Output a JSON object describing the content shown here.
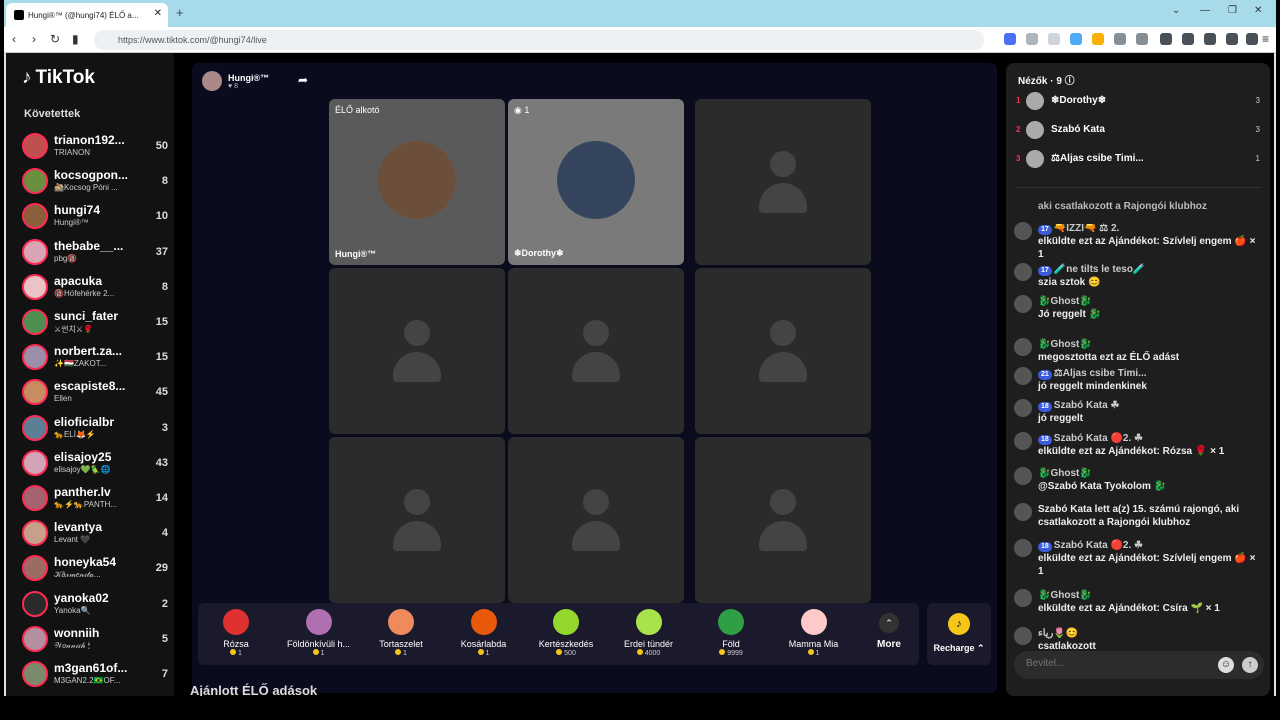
{
  "browser": {
    "tab_title": "Hungi®™ (@hungi74) ÉLŐ a...",
    "url": "https://www.tiktok.com/@hungi74/live"
  },
  "sidebar": {
    "logo": "TikTok",
    "following_title": "Követettek",
    "following": [
      {
        "name": "trianon192...",
        "sub": "TRIANON",
        "count": "50"
      },
      {
        "name": "kocsogpon...",
        "sub": "🚵Kocsog Póni ...",
        "count": "8"
      },
      {
        "name": "hungi74",
        "sub": "Hungi®™",
        "count": "10"
      },
      {
        "name": "thebabe__...",
        "sub": "pbg🔞",
        "count": "37"
      },
      {
        "name": "apacuka",
        "sub": "🔞Hófehérke 2...",
        "count": "8"
      },
      {
        "name": "sunci_fater",
        "sub": "⚔썬치⚔🌹",
        "count": "15"
      },
      {
        "name": "norbert.za...",
        "sub": "✨🇭🇺ZAKOT...",
        "count": "15"
      },
      {
        "name": "escapiste8...",
        "sub": "Ellen",
        "count": "45"
      },
      {
        "name": "elioficialbr",
        "sub": "🐆ELÍ🦊⚡",
        "count": "3"
      },
      {
        "name": "elisajoy25",
        "sub": "elisajoy💚🦜🌐",
        "count": "43"
      },
      {
        "name": "panther.lv",
        "sub": "🐆⚡🐆PANTH...",
        "count": "14"
      },
      {
        "name": "levantya",
        "sub": "Levant 🖤",
        "count": "4"
      },
      {
        "name": "honeyka54",
        "sub": "𝒦á𝓇𝓂𝑒𝓃𝒾𝓉𝒶...",
        "count": "29"
      },
      {
        "name": "yanoka02",
        "sub": "Yanoka🔍",
        "count": "2"
      },
      {
        "name": "wonniih",
        "sub": "𝒲𝑜𝓃𝓃𝒾𝒾𝒽 🕯",
        "count": "5"
      },
      {
        "name": "m3gan61of...",
        "sub": "M3GAN2.2🇧🇷OF...",
        "count": "7"
      }
    ]
  },
  "stream": {
    "host_name": "Hungi®™",
    "host_likes": "♥ 8",
    "live_creator_tag": "ÉLŐ alkotó",
    "cell1_name": "Hungi®™",
    "cell2_tag": "◉ 1",
    "cell2_name": "❄Dorothy❄"
  },
  "gifts": [
    {
      "name": "Rózsa",
      "price": "1",
      "color": "#e03131"
    },
    {
      "name": "Földönkívüli h...",
      "price": "1",
      "color": "#b06fb0"
    },
    {
      "name": "Tortaszelet",
      "price": "1",
      "color": "#f08a5d"
    },
    {
      "name": "Kosárlabda",
      "price": "1",
      "color": "#e8590c"
    },
    {
      "name": "Kertészkedés",
      "price": "500",
      "color": "#94d82d"
    },
    {
      "name": "Erdei tündér",
      "price": "4000",
      "color": "#a9e34b"
    },
    {
      "name": "Föld",
      "price": "9999",
      "color": "#2f9e44"
    },
    {
      "name": "Mamma Mia",
      "price": "1",
      "color": "#ffc9c9"
    }
  ],
  "more_label": "More",
  "recharge_label": "Recharge ⌃",
  "recommended_title": "Ajánlott ÉLŐ adások",
  "viewers": {
    "title": "Nézők · 9 ⓘ",
    "list": [
      {
        "rank": "1",
        "name": "❄Dorothy❄",
        "score": "3"
      },
      {
        "rank": "2",
        "name": "Szabó Kata",
        "score": "3"
      },
      {
        "rank": "3",
        "name": "⚖Aljas csibe Timi...",
        "score": "1"
      }
    ]
  },
  "chat": {
    "pre": "aki csatlakozott a Rajongói klubhoz",
    "messages": [
      {
        "badges": "17",
        "user": "🔫IZZI🔫 ⚖ 2.",
        "text": "elküldte ezt az Ajándékot: Szívlelj engem 🍎 × 1"
      },
      {
        "badges": "17",
        "user": "🧪ne tilts le teso🧪",
        "text": "szia sztok 😊"
      },
      {
        "badges": "",
        "user": "🐉Ghost🐉",
        "text": "Jó reggelt 🐉"
      },
      {
        "badges": "",
        "user": "🐉Ghost🐉",
        "text": "megosztotta ezt az ÉLŐ adást"
      },
      {
        "badges": "21",
        "user": "⚖Aljas csibe Timi...",
        "text": "jó reggelt mindenkinek"
      },
      {
        "badges": "18",
        "user": "Szabó Kata ☘",
        "text": "jó reggelt"
      },
      {
        "badges": "18",
        "user": "Szabó Kata 🔴2. ☘",
        "text": "elküldte ezt az Ajándékot: Rózsa 🌹 × 1"
      },
      {
        "badges": "",
        "user": "🐉Ghost🐉",
        "text": "@Szabó Kata Tyokolom 🐉"
      },
      {
        "badges": "",
        "user": "",
        "text": "Szabó Kata lett a(z) 15. számú rajongó, aki csatlakozott a Rajongói klubhoz"
      },
      {
        "badges": "18",
        "user": "Szabó Kata 🔴2. ☘",
        "text": "elküldte ezt az Ajándékot: Szívlelj engem 🍎 × 1"
      },
      {
        "badges": "",
        "user": "🐉Ghost🐉",
        "text": "elküldte ezt az Ajándékot: Csíra 🌱 × 1"
      },
      {
        "badges": "",
        "user": "ﺭﻳﺎﺀ🌷😊",
        "text": "csatlakozott"
      }
    ],
    "input_placeholder": "Bevitel..."
  }
}
